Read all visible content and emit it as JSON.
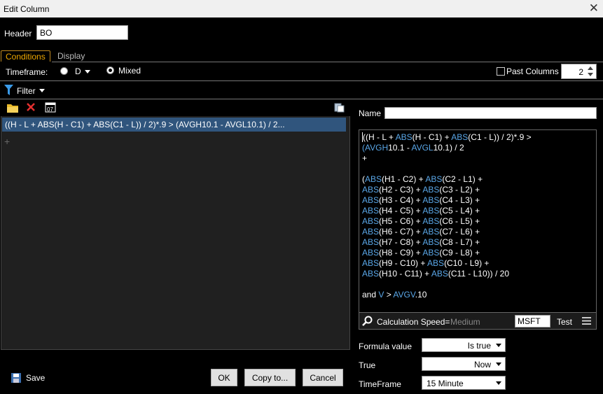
{
  "window": {
    "title": "Edit Column"
  },
  "header": {
    "label": "Header",
    "value": "BO"
  },
  "tabs": [
    {
      "label": "Conditions"
    },
    {
      "label": "Display"
    }
  ],
  "timeframe": {
    "label": "Timeframe:",
    "option_d": "D",
    "option_mixed": "Mixed"
  },
  "past_columns": {
    "label": "Past Columns",
    "value": "2"
  },
  "filter": {
    "label": "Filter"
  },
  "condition_row": "((H - L + ABS(H - C1) + ABS(C1 - L)) / 2)*.9 >  (AVGH10.1 - AVGL10.1) / 2...",
  "buttons": {
    "save": "Save",
    "ok": "OK",
    "copy": "Copy to...",
    "cancel": "Cancel",
    "test": "Test"
  },
  "name": {
    "label": "Name",
    "value": ""
  },
  "formula_lines": [
    [
      "",
      "((H - L + "
    ],
    [
      "f",
      "ABS"
    ],
    [
      "",
      "(H - C1) + "
    ],
    [
      "f",
      "ABS"
    ],
    [
      "",
      "(C1 - L)) / 2)*.9 >"
    ]
  ],
  "calc": {
    "label": "Calculation Speed=",
    "speed": "Medium",
    "symbol": "MSFT"
  },
  "formula_value": {
    "label": "Formula value",
    "value": "Is true"
  },
  "true_field": {
    "label": "True",
    "value": "Now"
  },
  "timeframe_select": {
    "label": "TimeFrame",
    "value": "15 Minute"
  },
  "icons": {
    "folder": "folder-icon",
    "delete": "delete-icon",
    "calendar": "calendar-icon",
    "paste": "paste-icon",
    "filter": "funnel-icon",
    "search": "magnifier-icon",
    "menu": "hamburger-icon",
    "save": "floppy-icon"
  },
  "colors": {
    "selected_row": "#30557d",
    "function": "#5aa7e8",
    "active_tab": "#f0a800"
  }
}
